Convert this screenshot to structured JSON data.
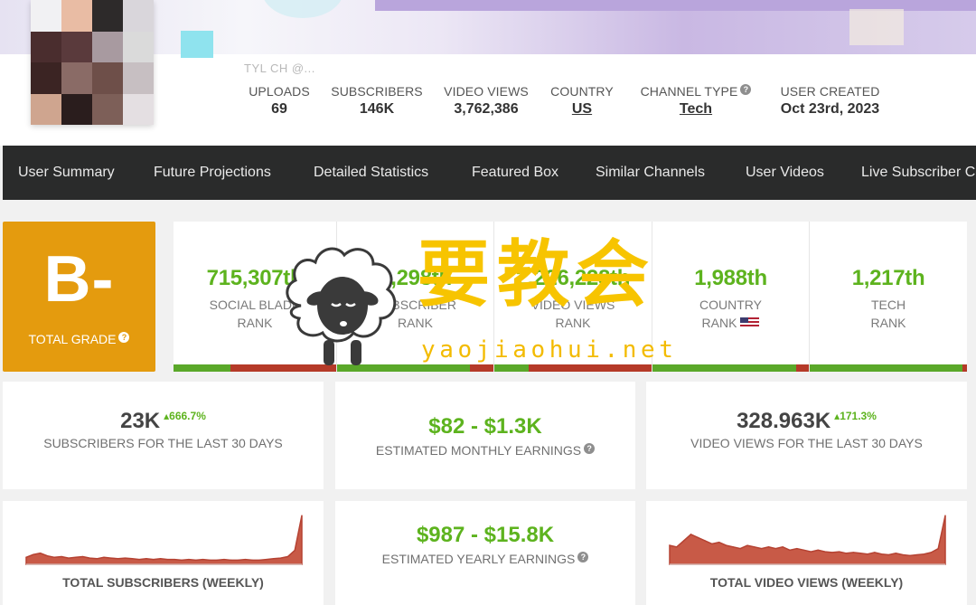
{
  "header": {
    "handle": "TYL CH  @...",
    "stats": [
      {
        "label": "UPLOADS",
        "value": "69"
      },
      {
        "label": "SUBSCRIBERS",
        "value": "146K"
      },
      {
        "label": "VIDEO VIEWS",
        "value": "3,762,386"
      },
      {
        "label": "COUNTRY",
        "value": "US"
      },
      {
        "label": "CHANNEL TYPE",
        "value": "Tech"
      },
      {
        "label": "USER CREATED",
        "value": "Oct 23rd, 2023"
      }
    ]
  },
  "nav": {
    "items": [
      "User Summary",
      "Future Projections",
      "Detailed Statistics",
      "Featured Box",
      "Similar Channels",
      "User Videos",
      "Live Subscriber Count"
    ]
  },
  "grade": {
    "value": "B-",
    "label": "TOTAL GRADE",
    "help": "?"
  },
  "ranks": [
    {
      "value": "715,307th",
      "line1": "SOCIAL BLADE",
      "line2": "RANK",
      "fill": 0.35
    },
    {
      "value": "2,298th",
      "line1": "SUBSCRIBER",
      "line2": "RANK",
      "fill": 0.85
    },
    {
      "value": "2,226,228th",
      "line1": "VIDEO VIEWS",
      "line2": "RANK",
      "fill": 0.22
    },
    {
      "value": "1,988th",
      "line1": "COUNTRY",
      "line2": "RANK",
      "fill": 0.92
    },
    {
      "value": "1,217th",
      "line1": "TECH",
      "line2": "RANK",
      "fill": 0.97
    }
  ],
  "cards": {
    "subs30": {
      "value": "23K",
      "change": "▴666.7%",
      "label": "SUBSCRIBERS FOR THE LAST 30 DAYS"
    },
    "monthly": {
      "value": "$82  -  $1.3K",
      "label": "ESTIMATED MONTHLY EARNINGS"
    },
    "views30": {
      "value": "328.963K",
      "change": "▴171.3%",
      "label": "VIDEO VIEWS FOR THE LAST 30 DAYS"
    },
    "yearly": {
      "value": "$987  -  $15.8K",
      "label": "ESTIMATED YEARLY EARNINGS"
    }
  },
  "chart_data": [
    {
      "type": "area",
      "title": "TOTAL SUBSCRIBERS (WEEKLY)",
      "x": [
        1,
        2,
        3,
        4,
        5,
        6,
        7,
        8,
        9,
        10,
        11,
        12,
        13,
        14,
        15,
        16,
        17,
        18,
        19,
        20,
        21,
        22,
        23,
        24,
        25,
        26,
        27,
        28,
        29,
        30,
        31,
        32,
        33,
        34,
        35,
        36,
        37,
        38,
        39,
        40
      ],
      "values": [
        10,
        14,
        16,
        12,
        10,
        11,
        9,
        10,
        11,
        9,
        8,
        10,
        9,
        8,
        9,
        8,
        7,
        8,
        7,
        8,
        7,
        7,
        6,
        7,
        6,
        7,
        6,
        6,
        7,
        6,
        6,
        7,
        6,
        6,
        7,
        8,
        9,
        11,
        20,
        70
      ],
      "ylim": [
        0,
        70
      ],
      "color": "#c85a47"
    },
    {
      "type": "area",
      "title": "TOTAL VIDEO VIEWS (WEEKLY)",
      "x": [
        1,
        2,
        3,
        4,
        5,
        6,
        7,
        8,
        9,
        10,
        11,
        12,
        13,
        14,
        15,
        16,
        17,
        18,
        19,
        20,
        21,
        22,
        23,
        24,
        25,
        26,
        27,
        28,
        29,
        30,
        31,
        32,
        33,
        34,
        35,
        36,
        37,
        38,
        39,
        40
      ],
      "values": [
        24,
        22,
        30,
        38,
        34,
        30,
        26,
        28,
        24,
        22,
        20,
        24,
        22,
        20,
        22,
        20,
        22,
        18,
        20,
        18,
        16,
        18,
        16,
        15,
        16,
        14,
        15,
        14,
        13,
        15,
        13,
        12,
        14,
        12,
        11,
        12,
        13,
        15,
        20,
        62
      ],
      "ylim": [
        0,
        62
      ],
      "color": "#c85a47"
    }
  ],
  "watermark": {
    "text": "要教会",
    "url": "yaojiaohui.net"
  }
}
